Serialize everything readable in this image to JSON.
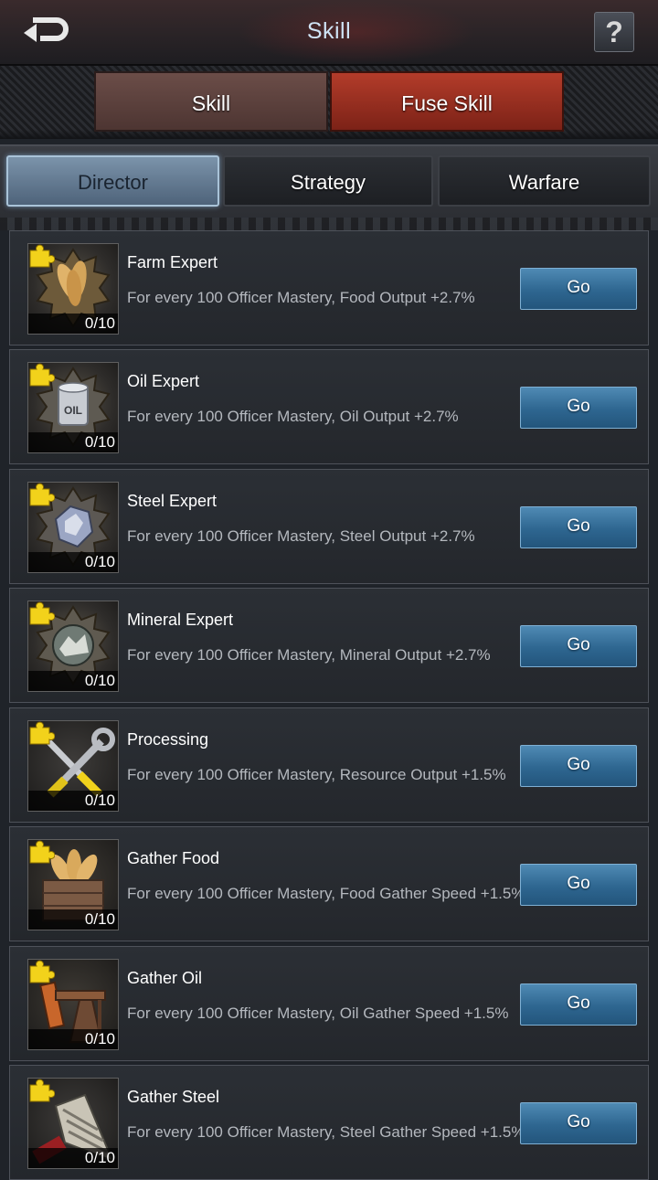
{
  "header": {
    "title": "Skill",
    "help_label": "?"
  },
  "top_tabs": {
    "skill": "Skill",
    "fuse_skill": "Fuse Skill"
  },
  "sub_tabs": {
    "director": "Director",
    "strategy": "Strategy",
    "warfare": "Warfare"
  },
  "colors": {
    "go_button": "#2e6690",
    "active_top_tab": "#b33c2a",
    "active_sub_tab": "#7b93aa",
    "puzzle_icon": "#f2d21b"
  },
  "skills": [
    {
      "name": "Farm Expert",
      "desc": "For every 100 Officer Mastery, Food Output +2.7%",
      "level": "0/10",
      "go": "Go",
      "icon": "wheat-icon"
    },
    {
      "name": "Oil Expert",
      "desc": "For every 100 Officer Mastery, Oil Output +2.7%",
      "level": "0/10",
      "go": "Go",
      "icon": "oil-barrel-icon"
    },
    {
      "name": "Steel Expert",
      "desc": "For every 100 Officer Mastery, Steel Output +2.7%",
      "level": "0/10",
      "go": "Go",
      "icon": "steel-icon"
    },
    {
      "name": "Mineral Expert",
      "desc": "For every 100 Officer Mastery, Mineral Output +2.7%",
      "level": "0/10",
      "go": "Go",
      "icon": "mineral-icon"
    },
    {
      "name": "Processing",
      "desc": "For every 100 Officer Mastery, Resource Output +1.5%",
      "level": "0/10",
      "go": "Go",
      "icon": "tools-icon"
    },
    {
      "name": "Gather Food",
      "desc": "For every 100 Officer Mastery, Food Gather Speed +1.5%",
      "level": "0/10",
      "go": "Go",
      "icon": "wheat-crate-icon"
    },
    {
      "name": "Gather Oil",
      "desc": "For every 100 Officer Mastery, Oil Gather Speed +1.5%",
      "level": "0/10",
      "go": "Go",
      "icon": "oil-pump-icon"
    },
    {
      "name": "Gather Steel",
      "desc": "For every 100 Officer Mastery, Steel Gather Speed +1.5%",
      "level": "0/10",
      "go": "Go",
      "icon": "drill-icon"
    }
  ]
}
